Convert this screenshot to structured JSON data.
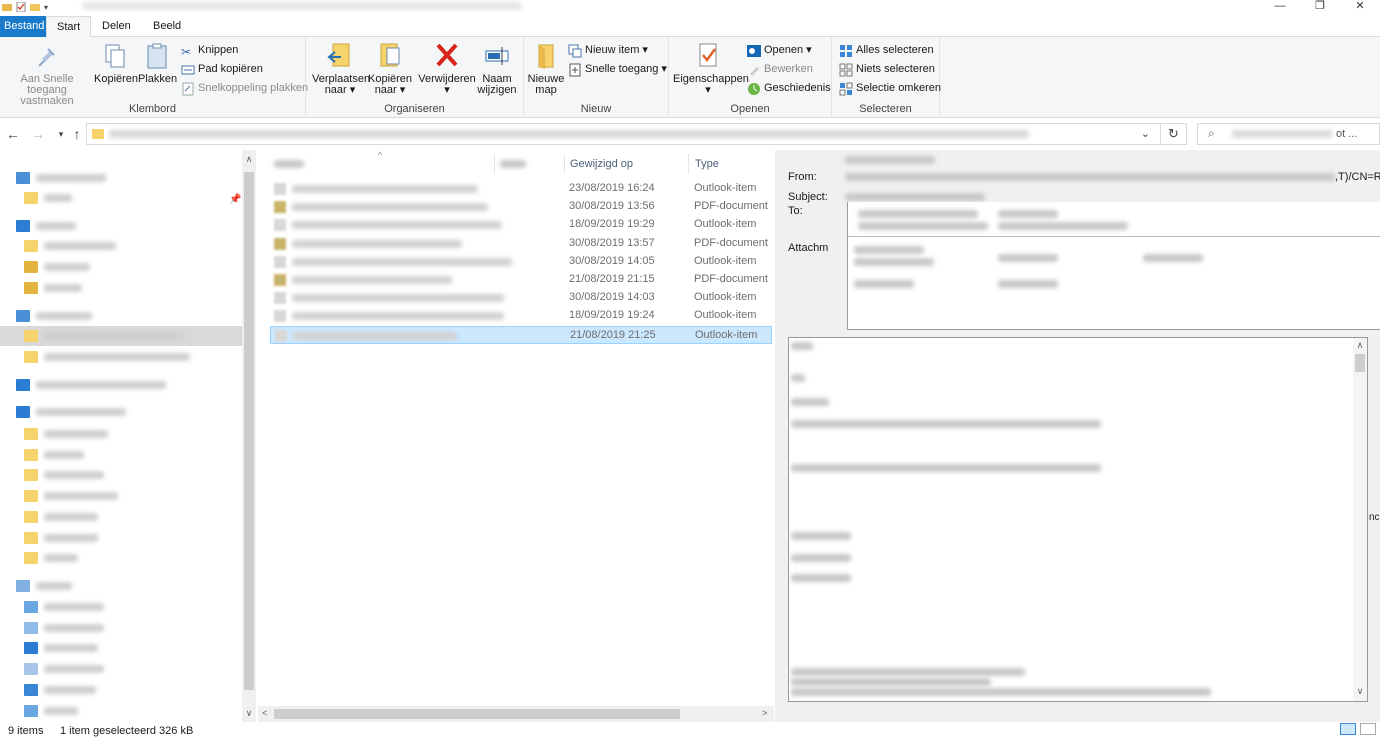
{
  "ribbon_tabs": {
    "file": "Bestand",
    "home": "Start",
    "share": "Delen",
    "view": "Beeld"
  },
  "clipboard": {
    "pin_label_1": "Aan Snelle toegang",
    "pin_label_2": "vastmaken",
    "copy": "Kopiëren",
    "paste": "Plakken",
    "cut": "Knippen",
    "copy_path": "Pad kopiëren",
    "paste_shortcut": "Snelkoppeling plakken",
    "group": "Klembord"
  },
  "organize": {
    "move_1": "Verplaatsen",
    "move_2": "naar",
    "copyto_1": "Kopiëren",
    "copyto_2": "naar",
    "delete": "Verwijderen",
    "rename_1": "Naam",
    "rename_2": "wijzigen",
    "group": "Organiseren"
  },
  "new": {
    "folder_1": "Nieuwe",
    "folder_2": "map",
    "new_item": "Nieuw item",
    "easy_access": "Snelle toegang",
    "group": "Nieuw"
  },
  "open": {
    "properties": "Eigenschappen",
    "open": "Openen",
    "edit": "Bewerken",
    "history": "Geschiedenis",
    "group": "Openen"
  },
  "select": {
    "all": "Alles selecteren",
    "none": "Niets selecteren",
    "invert": "Selectie omkeren",
    "group": "Selecteren"
  },
  "search": {
    "suffix": "ot ..."
  },
  "columns": {
    "modified": "Gewijzigd op",
    "type": "Type"
  },
  "files": [
    {
      "date": "23/08/2019 16:24",
      "type": "Outlook-item",
      "kind": "msg"
    },
    {
      "date": "30/08/2019 13:56",
      "type": "PDF-document",
      "kind": "pdf"
    },
    {
      "date": "18/09/2019 19:29",
      "type": "Outlook-item",
      "kind": "msg"
    },
    {
      "date": "30/08/2019 13:57",
      "type": "PDF-document",
      "kind": "pdf"
    },
    {
      "date": "30/08/2019 14:05",
      "type": "Outlook-item",
      "kind": "msg"
    },
    {
      "date": "21/08/2019 21:15",
      "type": "PDF-document",
      "kind": "pdf"
    },
    {
      "date": "30/08/2019 14:03",
      "type": "Outlook-item",
      "kind": "msg"
    },
    {
      "date": "18/09/2019 19:24",
      "type": "Outlook-item",
      "kind": "msg"
    },
    {
      "date": "21/08/2019 21:25",
      "type": "Outlook-item",
      "kind": "msg",
      "selected": true
    }
  ],
  "preview": {
    "from": "From:",
    "from_tail": ",T)/CN=RE",
    "subject": "Subject:",
    "to": "To:",
    "attachments": "Attachm",
    "edge_text": "nc"
  },
  "status": {
    "count": "9 items",
    "selection": "1 item geselecteerd  326 kB"
  },
  "colors": {
    "accent": "#1979ca",
    "selection": "#cce8ff",
    "selection_border": "#99d1ff",
    "ribbon": "#f5f6f7"
  }
}
